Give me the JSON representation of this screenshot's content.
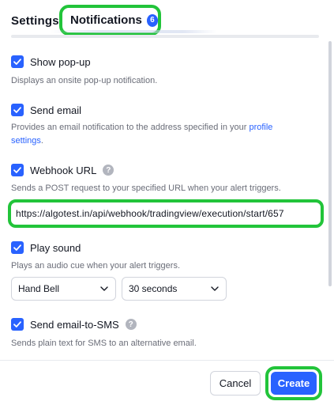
{
  "tabs": {
    "settings_label": "Settings",
    "notifications_label": "Notifications",
    "notifications_count": "6"
  },
  "options": {
    "popup": {
      "label": "Show pop-up",
      "checked": true,
      "description": "Displays an onsite pop-up notification."
    },
    "email": {
      "label": "Send email",
      "checked": true,
      "description_prefix": "Provides an email notification to the address specified in your ",
      "description_link": "profile settings",
      "description_link_line1": "profile",
      "description_link_line2": "settings",
      "description_suffix": "."
    },
    "webhook": {
      "label": "Webhook URL",
      "checked": true,
      "help_icon": "question-icon",
      "description": "Sends a POST request to your specified URL when your alert triggers.",
      "url_value": "https://algotest.in/api/webhook/tradingview/execution/start/657"
    },
    "sound": {
      "label": "Play sound",
      "checked": true,
      "description": "Plays an audio cue when your alert triggers.",
      "sound_select": "Hand Bell",
      "duration_select": "30 seconds"
    },
    "sms": {
      "label": "Send email-to-SMS",
      "checked": true,
      "help_icon": "question-icon",
      "description": "Sends plain text for SMS to an alternative email."
    }
  },
  "footer": {
    "cancel_label": "Cancel",
    "create_label": "Create"
  },
  "colors": {
    "accent": "#2962ff",
    "highlight": "#22c43a",
    "muted_text": "#6a6d78"
  }
}
